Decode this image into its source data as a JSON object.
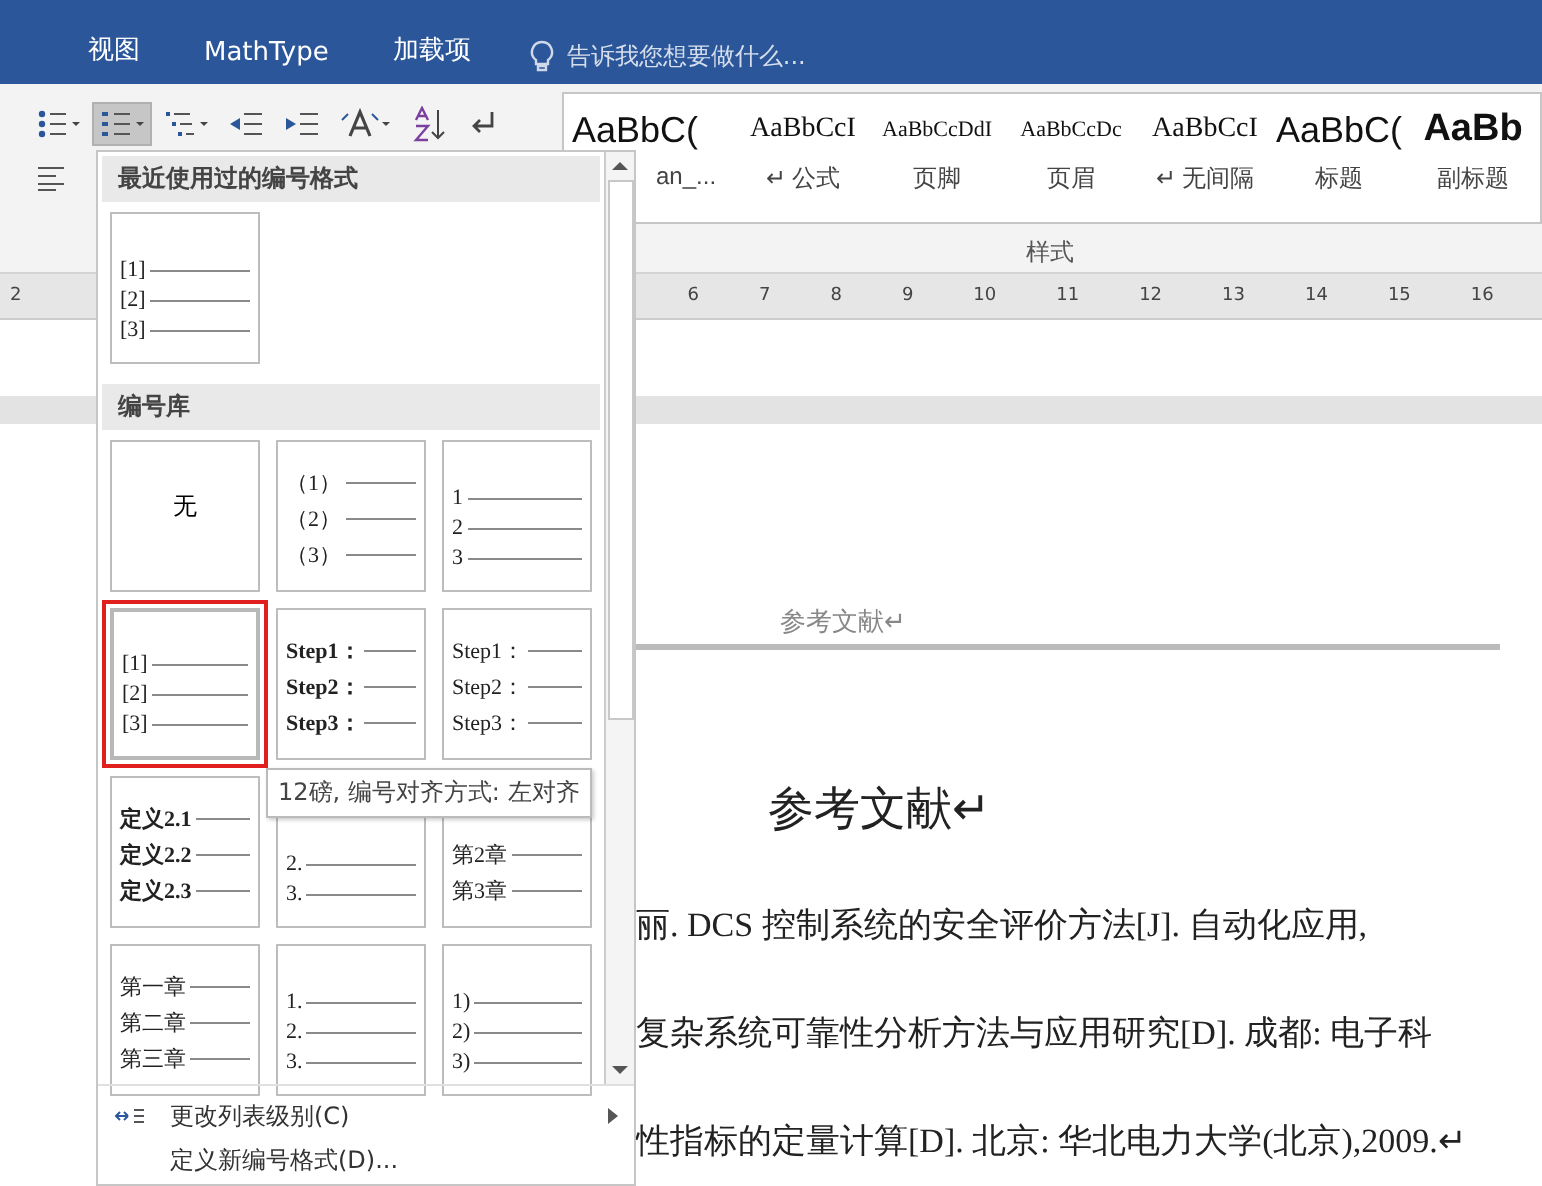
{
  "ribbon_tabs": [
    {
      "label": "视图",
      "selected": false
    },
    {
      "label": "MathType",
      "selected": false
    },
    {
      "label": "加载项",
      "selected": false
    }
  ],
  "tell_me": {
    "placeholder": "告诉我您想要做什么..."
  },
  "paragraph_tools": [
    {
      "kind": "bullets",
      "pressed": false
    },
    {
      "kind": "numbering",
      "pressed": true
    },
    {
      "kind": "multilevel",
      "pressed": false
    },
    {
      "kind": "outdent",
      "pressed": false
    },
    {
      "kind": "indent",
      "pressed": false
    },
    {
      "kind": "asian-layout",
      "pressed": false
    },
    {
      "kind": "sort",
      "pressed": false
    },
    {
      "kind": "marks",
      "pressed": false
    }
  ],
  "styles": {
    "items": [
      {
        "preview": "AaBbC(",
        "label": "an_...",
        "kind": "heading"
      },
      {
        "preview": "AaBbCcI",
        "label": "↵ 公式",
        "kind": "serif"
      },
      {
        "preview": "AaBbCcDdI",
        "label": "页脚",
        "kind": "small"
      },
      {
        "preview": "AaBbCcDc",
        "label": "页眉",
        "kind": "small"
      },
      {
        "preview": "AaBbCcI",
        "label": "↵ 无间隔",
        "kind": "serif"
      },
      {
        "preview": "AaBbC(",
        "label": "标题",
        "kind": "heading"
      },
      {
        "preview": "AaBb",
        "label": "副标题",
        "kind": "bold"
      }
    ],
    "group_label": "样式"
  },
  "ruler": {
    "left_labels": [
      "2"
    ],
    "right_labels": [
      "6",
      "7",
      "8",
      "9",
      "10",
      "11",
      "12",
      "13",
      "14",
      "15",
      "16"
    ]
  },
  "document": {
    "header": "参考文献↵",
    "title": "参考文献↵",
    "lines": [
      "丽. DCS 控制系统的安全评价方法[J]. 自动化应用,",
      "复杂系统可靠性分析方法与应用研究[D]. 成都: 电子科",
      "性指标的定量计算[D]. 北京: 华北电力大学(北京),2009.↵"
    ]
  },
  "numbering_menu": {
    "recent_title": "最近使用过的编号格式",
    "recent": [
      {
        "kind": "list",
        "lines": [
          "[1]",
          "[2]",
          "[3]"
        ],
        "bold": false,
        "selected": false
      }
    ],
    "library_title": "编号库",
    "library": [
      {
        "kind": "none",
        "label": "无",
        "selected": false
      },
      {
        "kind": "list",
        "lines": [
          "（1）",
          "（2）",
          "（3）"
        ],
        "bold": false,
        "selected": false
      },
      {
        "kind": "list",
        "lines": [
          "1",
          "2",
          "3"
        ],
        "bold": false,
        "selected": false
      },
      {
        "kind": "list",
        "lines": [
          "[1]",
          "[2]",
          "[3]"
        ],
        "bold": false,
        "selected": true
      },
      {
        "kind": "list",
        "lines": [
          "Step1：",
          "Step2：",
          "Step3："
        ],
        "bold": true,
        "selected": false
      },
      {
        "kind": "list",
        "lines": [
          "Step1：",
          "Step2：",
          "Step3："
        ],
        "bold": false,
        "selected": false
      },
      {
        "kind": "list",
        "lines": [
          "定义2.1",
          "定义2.2",
          "定义2.3"
        ],
        "bold": true,
        "selected": false
      },
      {
        "kind": "list",
        "lines": [
          "2.",
          "3."
        ],
        "bold": false,
        "selected": false
      },
      {
        "kind": "list",
        "lines": [
          "第2章",
          "第3章"
        ],
        "bold": false,
        "selected": false
      },
      {
        "kind": "list",
        "lines": [
          "第一章",
          "第二章",
          "第三章"
        ],
        "bold": false,
        "selected": false
      },
      {
        "kind": "list",
        "lines": [
          "1.",
          "2.",
          "3."
        ],
        "bold": false,
        "selected": false
      },
      {
        "kind": "list",
        "lines": [
          "1)",
          "2)",
          "3)"
        ],
        "bold": false,
        "selected": false
      }
    ],
    "commands": [
      {
        "label": "更改列表级别(C)",
        "kind": "submenu"
      },
      {
        "label": "定义新编号格式(D)...",
        "kind": "plain"
      }
    ],
    "tooltip": "12磅, 编号对齐方式: 左对齐"
  }
}
